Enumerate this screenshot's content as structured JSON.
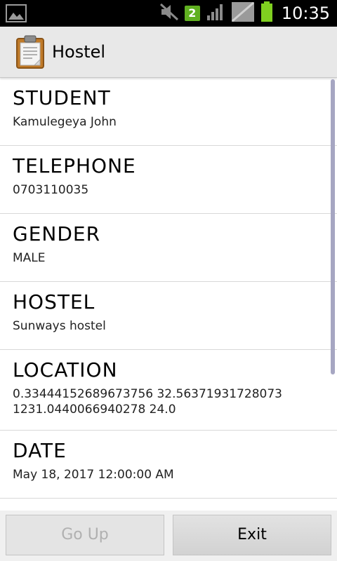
{
  "status_bar": {
    "notification_count": "2",
    "time": "10:35",
    "icons": [
      "image-notification-icon",
      "mute-icon",
      "signal-icon",
      "no-sim-icon",
      "battery-icon"
    ]
  },
  "action_bar": {
    "title": "Hostel",
    "icon": "clipboard-icon"
  },
  "fields": [
    {
      "label": "STUDENT",
      "value": "Kamulegeya John"
    },
    {
      "label": "TELEPHONE",
      "value": "0703110035"
    },
    {
      "label": "GENDER",
      "value": "MALE"
    },
    {
      "label": "HOSTEL",
      "value": "Sunways hostel"
    },
    {
      "label": "LOCATION",
      "value_line1": "0.33444152689673756 32.56371931728073",
      "value_line2": "1231.0440066940278 24.0"
    },
    {
      "label": "DATE",
      "value": "May 18, 2017 12:00:00 AM"
    }
  ],
  "buttons": {
    "go_up": "Go Up",
    "exit": "Exit"
  },
  "colors": {
    "status_bar_bg": "#000000",
    "action_bar_bg": "#e8e8e8",
    "badge_green": "#60b020",
    "battery_green": "#80d020",
    "scrollbar": "#a6a6c2"
  }
}
